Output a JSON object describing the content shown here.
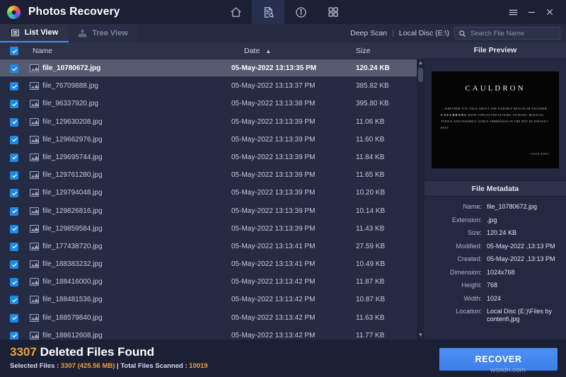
{
  "window": {
    "app_title": "Photos Recovery",
    "logo_icon": "photos-logo-icon",
    "nav_icons": [
      {
        "name": "home-icon",
        "label": "Home",
        "active": false
      },
      {
        "name": "scan-document-icon",
        "label": "Scan",
        "active": true
      },
      {
        "name": "info-icon",
        "label": "Info",
        "active": false
      },
      {
        "name": "grid-icon",
        "label": "Grid",
        "active": false
      }
    ],
    "controls": [
      {
        "name": "menu-icon",
        "glyph": "☰"
      },
      {
        "name": "minimize-icon",
        "glyph": "–"
      },
      {
        "name": "close-icon",
        "glyph": "✕"
      }
    ]
  },
  "tabs": [
    {
      "label": "List View",
      "icon": "list-view-icon",
      "active": true
    },
    {
      "label": "Tree View",
      "icon": "tree-view-icon",
      "active": false
    }
  ],
  "toolbar": {
    "scan_mode": "Deep Scan",
    "separator": "|",
    "drive": "Local Disc (E:\\)",
    "search_icon": "search-icon",
    "search_placeholder": "Search File Name",
    "search_value": "",
    "clear_icon": "close-icon",
    "clear_glyph": "✕"
  },
  "list": {
    "columns": {
      "check": "select-all-checkbox",
      "name": "Name",
      "date": "Date",
      "size": "Size",
      "sort_arrow": "▲",
      "sort_column": "Date",
      "sort_direction": "asc"
    },
    "rows": [
      {
        "name": "file_10780672.jpg",
        "date": "05-May-2022 13:13:35 PM",
        "size": "120.24 KB",
        "checked": true,
        "selected": true
      },
      {
        "name": "file_76709888.jpg",
        "date": "05-May-2022 13:13:37 PM",
        "size": "385.82 KB",
        "checked": true,
        "selected": false
      },
      {
        "name": "file_96337920.jpg",
        "date": "05-May-2022 13:13:38 PM",
        "size": "395.80 KB",
        "checked": true,
        "selected": false
      },
      {
        "name": "file_129630208.jpg",
        "date": "05-May-2022 13:13:39 PM",
        "size": "11.06 KB",
        "checked": true,
        "selected": false
      },
      {
        "name": "file_129662976.jpg",
        "date": "05-May-2022 13:13:39 PM",
        "size": "11.60 KB",
        "checked": true,
        "selected": false
      },
      {
        "name": "file_129695744.jpg",
        "date": "05-May-2022 13:13:39 PM",
        "size": "11.84 KB",
        "checked": true,
        "selected": false
      },
      {
        "name": "file_129761280.jpg",
        "date": "05-May-2022 13:13:39 PM",
        "size": "11.65 KB",
        "checked": true,
        "selected": false
      },
      {
        "name": "file_129794048.jpg",
        "date": "05-May-2022 13:13:39 PM",
        "size": "10.20 KB",
        "checked": true,
        "selected": false
      },
      {
        "name": "file_129826816.jpg",
        "date": "05-May-2022 13:13:39 PM",
        "size": "10.14 KB",
        "checked": true,
        "selected": false
      },
      {
        "name": "file_129859584.jpg",
        "date": "05-May-2022 13:13:39 PM",
        "size": "11.43 KB",
        "checked": true,
        "selected": false
      },
      {
        "name": "file_177438720.jpg",
        "date": "05-May-2022 13:13:41 PM",
        "size": "27.59 KB",
        "checked": true,
        "selected": false
      },
      {
        "name": "file_188383232.jpg",
        "date": "05-May-2022 13:13:41 PM",
        "size": "10.49 KB",
        "checked": true,
        "selected": false
      },
      {
        "name": "file_188416000.jpg",
        "date": "05-May-2022 13:13:42 PM",
        "size": "11.87 KB",
        "checked": true,
        "selected": false
      },
      {
        "name": "file_188481536.jpg",
        "date": "05-May-2022 13:13:42 PM",
        "size": "10.87 KB",
        "checked": true,
        "selected": false
      },
      {
        "name": "file_188579840.jpg",
        "date": "05-May-2022 13:13:42 PM",
        "size": "11.63 KB",
        "checked": true,
        "selected": false
      },
      {
        "name": "file_188612608.jpg",
        "date": "05-May-2022 13:13:42 PM",
        "size": "11.77 KB",
        "checked": true,
        "selected": false
      }
    ]
  },
  "preview": {
    "title": "File Preview",
    "image": {
      "heading": "CAULDRON",
      "body_lead": "... WHETHER YOU TALK ABOUT THE EARTHLY REALM OR ANOTHER,",
      "body_bold": "CAULDRONS",
      "body_rest": "HAVE CONCOCTED ELIXIRS, POTIONS, MAGICAL TONICS AND POSSIBLY GODLY AMBROSIAS IN THE NOT SO DISTANT PAST.",
      "signature": "- SAGE KING"
    }
  },
  "metadata": {
    "title": "File Metadata",
    "fields": [
      {
        "key": "Name:",
        "value": "file_10780672.jpg"
      },
      {
        "key": "Extension:",
        "value": ".jpg"
      },
      {
        "key": "Size:",
        "value": "120.24 KB"
      },
      {
        "key": "Modified:",
        "value": "05-May-2022 ,13:13 PM"
      },
      {
        "key": "Created:",
        "value": "05-May-2022 ,13:13 PM"
      },
      {
        "key": "Dimension:",
        "value": "1024x768"
      },
      {
        "key": "Height:",
        "value": "768"
      },
      {
        "key": "Width:",
        "value": "1024"
      },
      {
        "key": "Location:",
        "value": "Local Disc (E:)\\Files by content\\.jpg"
      }
    ]
  },
  "status": {
    "found_count": "3307",
    "found_label": "Deleted Files Found",
    "selected_prefix": "Selected Files : ",
    "selected_value": "3307 (425.56 MB)",
    "mid_sep": " | ",
    "scanned_prefix": "Total Files Scanned : ",
    "scanned_value": "10019",
    "recover_label": "RECOVER",
    "watermark": "wsxdn.com"
  },
  "colors": {
    "accent_blue": "#4d90f5",
    "amber": "#e8a33d",
    "checkbox_blue": "#1e8ae8",
    "titlebar_bg": "#1b2034",
    "list_bg": "#242b42",
    "selected_row": "#555b70"
  }
}
